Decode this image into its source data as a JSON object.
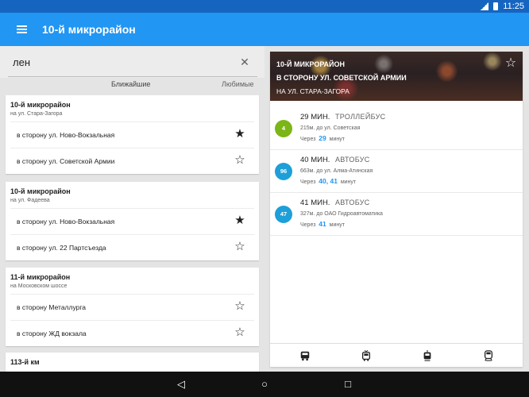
{
  "status": {
    "time": "11:25"
  },
  "app": {
    "title": "10-й микрорайон"
  },
  "search": {
    "value": "лен"
  },
  "tabs": {
    "nearby": "Ближайшие",
    "favorites": "Любимые"
  },
  "stops": [
    {
      "name": "10-й микрорайон",
      "street": "на ул. Стара-Загора",
      "directions": [
        {
          "label": "в сторону ул. Ново-Вокзальная",
          "favorite": true
        },
        {
          "label": "в сторону ул. Советской Армии",
          "favorite": false
        }
      ]
    },
    {
      "name": "10-й микрорайон",
      "street": "на ул. Фадеева",
      "directions": [
        {
          "label": "в сторону ул. Ново-Вокзальная",
          "favorite": true
        },
        {
          "label": "в сторону ул. 22 Партсъезда",
          "favorite": false
        }
      ]
    },
    {
      "name": "11-й микрорайон",
      "street": "на Московском шоссе",
      "directions": [
        {
          "label": "в сторону Металлурга",
          "favorite": false
        },
        {
          "label": "в сторону ЖД вокзала",
          "favorite": false
        }
      ]
    },
    {
      "name": "113-й км",
      "street": "",
      "directions": []
    }
  ],
  "detail": {
    "stop_title": "10-Й МИКРОРАЙОН",
    "direction": "В СТОРОНУ УЛ. СОВЕТСКОЙ АРМИИ",
    "street": "НА УЛ. СТАРА-ЗАГОРА",
    "arrivals": [
      {
        "route": "4",
        "badge_color": "#7cb518",
        "time": "29 МИН.",
        "type": "ТРОЛЛЕЙБУС",
        "distance": "215м. до ул. Советская",
        "through_label": "Через",
        "mins": "29",
        "mins_unit": "минут"
      },
      {
        "route": "96",
        "badge_color": "#1e9fd8",
        "time": "40 МИН.",
        "type": "АВТОБУС",
        "distance": "663м. до ул. Алма-Атинская",
        "through_label": "Через",
        "mins": "40,  41",
        "mins_unit": "минут"
      },
      {
        "route": "47",
        "badge_color": "#1e9fd8",
        "time": "41 МИН.",
        "type": "АВТОБУС",
        "distance": "327м. до ОАО Гидроавтоматика",
        "through_label": "Через",
        "mins": "41",
        "mins_unit": "минут"
      }
    ]
  },
  "icons": {
    "menu": "menu-icon",
    "clear": "close-icon",
    "star_filled": "star-filled-icon",
    "star_outline": "star-outline-icon",
    "bottom": [
      "bus-icon",
      "trolleybus-icon",
      "tram-icon",
      "train-icon"
    ],
    "nav": [
      "back-icon",
      "home-icon",
      "recents-icon"
    ]
  }
}
